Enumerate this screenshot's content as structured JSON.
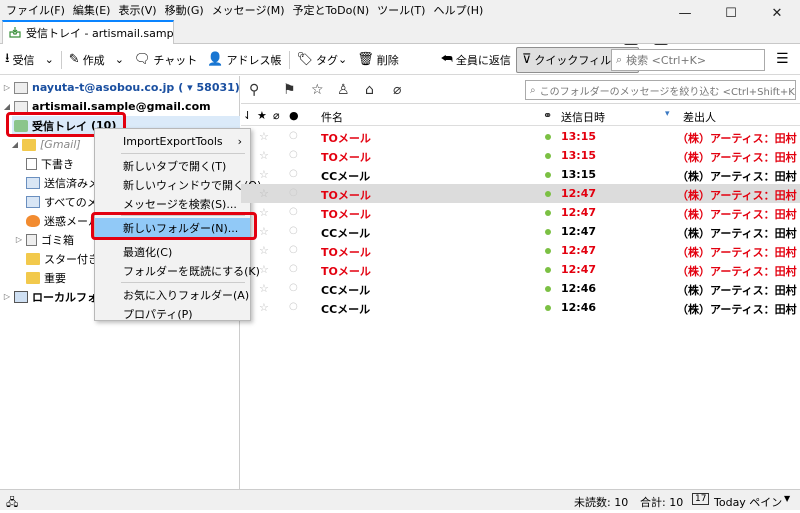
{
  "menubar": [
    "ファイル(F)",
    "編集(E)",
    "表示(V)",
    "移動(G)",
    "メッセージ(M)",
    "予定とToDo(N)",
    "ツール(T)",
    "ヘルプ(H)"
  ],
  "window_buttons": {
    "minimize": "—",
    "maximize": "☐",
    "close": "✕"
  },
  "tab": {
    "title": "受信トレイ - artismail.sample@g"
  },
  "toolbar": {
    "receive": "受信",
    "compose": "作成",
    "chat": "チャット",
    "addressbook": "アドレス帳",
    "tag": "タグ",
    "delete": "削除",
    "reply_all": "全員に返信",
    "quick_filter": "クイックフィルター",
    "search_placeholder": "検索 <Ctrl+K>"
  },
  "folders": {
    "account1": "nayuta-t@asobou.co.jp",
    "account1_count": "( ▾ 58031)",
    "account2": "artismail.sample@gmail.com",
    "inbox": "受信トレイ",
    "inbox_count": "(10)",
    "gmail": "[Gmail]",
    "drafts": "下書き",
    "sent": "送信済みメ",
    "all_mail": "すべてのメ",
    "spam": "迷惑メール",
    "trash": "ゴミ箱",
    "starred": "スター付き",
    "important": "重要",
    "local": "ローカルフォルダ"
  },
  "context_menu": {
    "import_export": "ImportExportTools",
    "open_new_tab": "新しいタブで開く(T)",
    "open_new_window": "新しいウィンドウで開く(O)",
    "search_messages": "メッセージを検索(S)...",
    "new_folder": "新しいフォルダー(N)...",
    "compact": "最適化(C)",
    "mark_read": "フォルダーを既読にする(K)",
    "favorite": "お気に入りフォルダー(A)",
    "properties": "プロパティ(P)"
  },
  "message_toolbar": {
    "filter_placeholder": "このフォルダーのメッセージを絞り込む <Ctrl+Shift+K>"
  },
  "columns": {
    "subject": "件名",
    "date": "送信日時",
    "sender": "差出人"
  },
  "messages": [
    {
      "subject": "TOメール",
      "date": "13:15",
      "sender": "（株）アーティス：田村",
      "red": true
    },
    {
      "subject": "TOメール",
      "date": "13:15",
      "sender": "（株）アーティス：田村",
      "red": true
    },
    {
      "subject": "CCメール",
      "date": "13:15",
      "sender": "（株）アーティス：田村",
      "red": false
    },
    {
      "subject": "TOメール",
      "date": "12:47",
      "sender": "（株）アーティス：田村",
      "red": true
    },
    {
      "subject": "TOメール",
      "date": "12:47",
      "sender": "（株）アーティス：田村",
      "red": true
    },
    {
      "subject": "CCメール",
      "date": "12:47",
      "sender": "（株）アーティス：田村",
      "red": false
    },
    {
      "subject": "TOメール",
      "date": "12:47",
      "sender": "（株）アーティス：田村",
      "red": true
    },
    {
      "subject": "TOメール",
      "date": "12:47",
      "sender": "（株）アーティス：田村",
      "red": true
    },
    {
      "subject": "CCメール",
      "date": "12:46",
      "sender": "（株）アーティス：田村",
      "red": false
    },
    {
      "subject": "CCメール",
      "date": "12:46",
      "sender": "（株）アーティス：田村",
      "red": false
    }
  ],
  "status": {
    "unread": "未読数: 10",
    "total": "合計: 10",
    "today_pane": "Today ペイン"
  },
  "colors": {
    "highlight_red": "#e3000f",
    "menu_highlight": "#91c9f7",
    "unread_dot": "#7bc043"
  }
}
